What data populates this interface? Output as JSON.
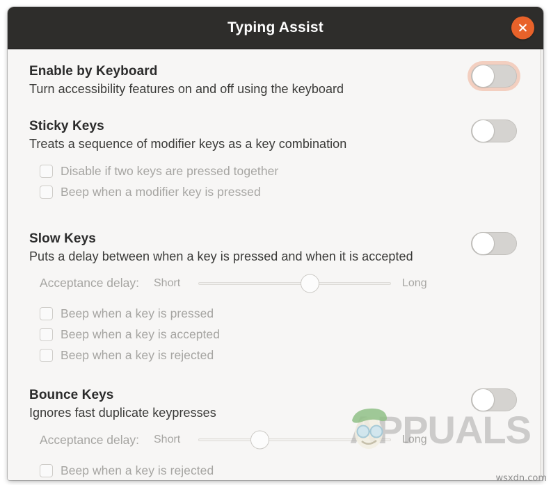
{
  "window": {
    "title": "Typing Assist",
    "close_icon": "close-x-icon",
    "accent_color": "#e8622a",
    "titlebar_color": "#2e2d2b",
    "content_color": "#f7f6f5"
  },
  "sections": [
    {
      "id": "enable-by-keyboard",
      "title": "Enable by Keyboard",
      "description": "Turn accessibility features on and off using the keyboard",
      "toggle": {
        "state": "off",
        "focused": true
      },
      "checkboxes": [],
      "slider": null
    },
    {
      "id": "sticky-keys",
      "title": "Sticky Keys",
      "description": "Treats a sequence of modifier keys as a key combination",
      "toggle": {
        "state": "off",
        "focused": false
      },
      "checkboxes": [
        {
          "label": "Disable if two keys are pressed together",
          "checked": false,
          "disabled": true
        },
        {
          "label": "Beep when a modifier key is pressed",
          "checked": false,
          "disabled": true
        }
      ],
      "slider": null
    },
    {
      "id": "slow-keys",
      "title": "Slow Keys",
      "description": "Puts a delay between when a key is pressed and when it is accepted",
      "toggle": {
        "state": "off",
        "focused": false
      },
      "slider": {
        "label": "Acceptance delay:",
        "min_label": "Short",
        "max_label": "Long",
        "value_percent": 58
      },
      "checkboxes": [
        {
          "label": "Beep when a key is pressed",
          "checked": false,
          "disabled": true
        },
        {
          "label": "Beep when a key is accepted",
          "checked": false,
          "disabled": true
        },
        {
          "label": "Beep when a key is rejected",
          "checked": false,
          "disabled": true
        }
      ]
    },
    {
      "id": "bounce-keys",
      "title": "Bounce Keys",
      "description": "Ignores fast duplicate keypresses",
      "toggle": {
        "state": "off",
        "focused": false
      },
      "slider": {
        "label": "Acceptance delay:",
        "min_label": "Short",
        "max_label": "Long",
        "value_percent": 32
      },
      "checkboxes": [
        {
          "label": "Beep when a key is rejected",
          "checked": false,
          "disabled": true
        }
      ]
    }
  ],
  "watermark": {
    "text": "APPUALS",
    "mascot_icon": "appuals-mascot-icon"
  },
  "credit": {
    "text": "wsxdn.com"
  }
}
